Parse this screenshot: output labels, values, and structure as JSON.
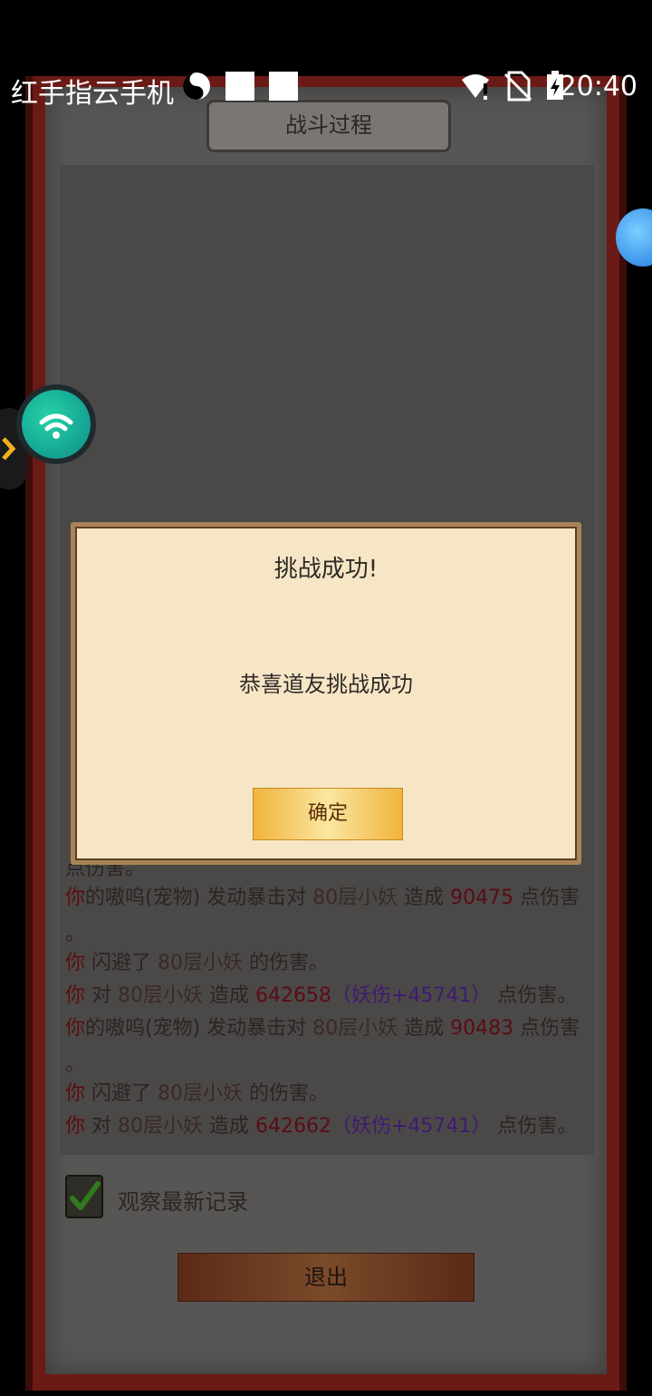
{
  "status_bar": {
    "carrier": "红手指云手机",
    "time": "20:40",
    "icons": [
      "yin-yang-icon",
      "white-square-icon",
      "white-square-icon",
      "wifi-alert-icon",
      "no-sim-icon",
      "battery-charging-icon"
    ]
  },
  "panel": {
    "title": "战斗过程",
    "log": {
      "line1": {
        "a": "你",
        "b": "的嗷呜(宠物) 发动暴击对 ",
        "c": "80层小妖",
        "d": " 造成 ",
        "e": "90475",
        "f": " 点伤害"
      },
      "dot1": "。",
      "line2": {
        "a": "你",
        "b": " 闪避了 ",
        "c": "80层小妖",
        "d": " 的伤害。"
      },
      "line3": {
        "a": "你",
        "b": " 对 ",
        "c": "80层小妖",
        "d": " 造成 ",
        "e": "642658",
        "f": "（妖伤+45741）",
        "g": " 点伤害。"
      },
      "line4": {
        "a": "你",
        "b": "的嗷呜(宠物) 发动暴击对 ",
        "c": "80层小妖",
        "d": " 造成 ",
        "e": "90483",
        "f": " 点伤害"
      },
      "dot2": "。",
      "line5": {
        "a": "你",
        "b": " 闪避了 ",
        "c": "80层小妖",
        "d": " 的伤害。"
      },
      "line6": {
        "a": "你",
        "b": " 对 ",
        "c": "80层小妖",
        "d": " 造成 ",
        "e": "642662",
        "f": "（妖伤+45741）",
        "g": " 点伤害。"
      },
      "partial": "点伤害。"
    },
    "checkbox_label": "观察最新记录",
    "checkbox_checked": true,
    "exit_label": "退出"
  },
  "dialog": {
    "title": "挑战成功!",
    "message": "恭喜道友挑战成功",
    "ok_label": "确定"
  },
  "colors": {
    "you": "#5a0e0e",
    "damage": "#5a0c14",
    "pet_damage": "#401a70",
    "button_gold": "#f0b43c"
  }
}
